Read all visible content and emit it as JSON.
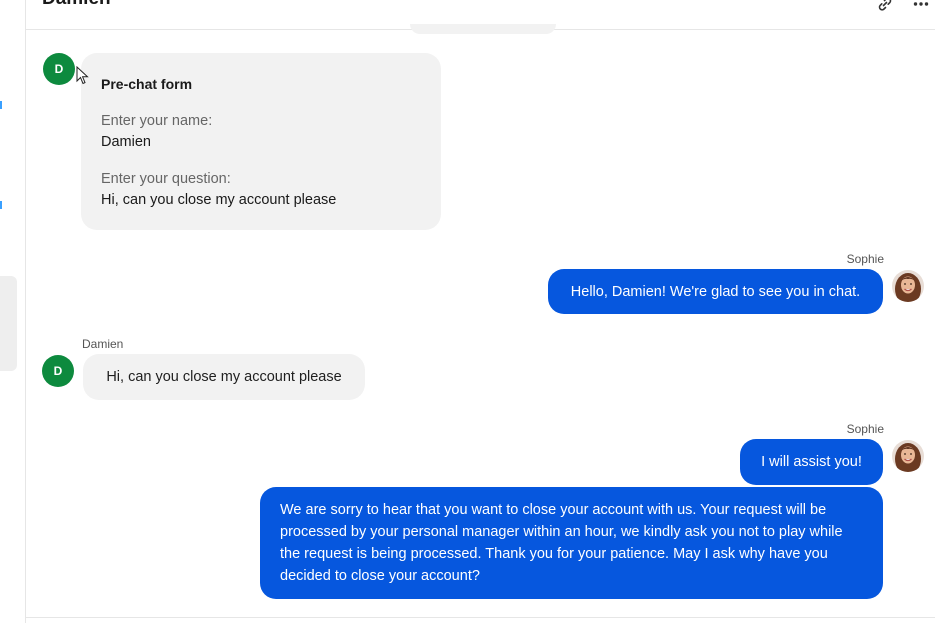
{
  "header": {
    "title": "Damien"
  },
  "messages": {
    "prechat": {
      "avatar_letter": "D",
      "title": "Pre-chat form",
      "name_label": "Enter your name:",
      "name_value": "Damien",
      "question_label": "Enter your question:",
      "question_value": "Hi, can you close my account please"
    },
    "agent_1": {
      "sender": "Sophie",
      "text": "Hello, Damien! We're glad to see you in chat."
    },
    "customer_1": {
      "sender": "Damien",
      "avatar_letter": "D",
      "text": "Hi, can you close my account please"
    },
    "agent_2": {
      "sender": "Sophie",
      "text": "I will assist you!",
      "text_2": "We are sorry to hear that you want to close your account with us. Your request will be processed by your personal manager within an hour, we kindly ask you not to play while the request is being processed. Thank you for your patience. May I ask why have you decided to close your account?"
    }
  },
  "colors": {
    "agent_bubble": "#0657de",
    "customer_bubble": "#f2f2f2",
    "customer_avatar": "#0d8a3e"
  },
  "icons": {
    "link": "link-icon",
    "more": "more-icon"
  }
}
